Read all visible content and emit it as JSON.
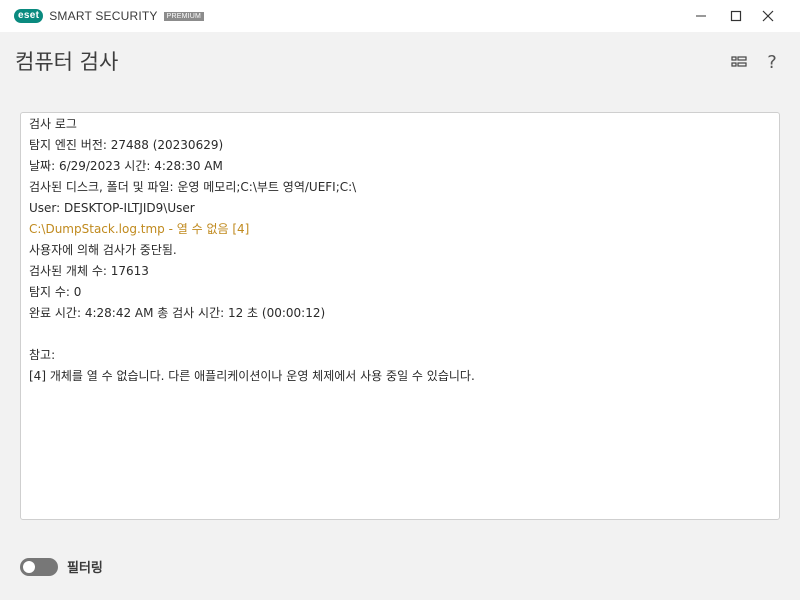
{
  "app": {
    "logo_text": "eset",
    "product_name": "SMART SECURITY",
    "edition": "PREMIUM",
    "accent_color": "#0a8a7f",
    "window_controls": [
      "minimize-icon",
      "maximize-icon",
      "close-icon"
    ]
  },
  "header": {
    "title": "컴퓨터 검사",
    "layout_icon": "layout-icon",
    "help_label": "?"
  },
  "log": {
    "lines": [
      "검사 로그",
      "탐지 엔진 버전: 27488 (20230629)",
      "날짜: 6/29/2023  시간: 4:28:30 AM",
      "검사된 디스크, 폴더 및 파일: 운영 메모리;C:\\부트 영역/UEFI;C:\\",
      "User: DESKTOP-ILTJID9\\User",
      "C:\\DumpStack.log.tmp - 열 수 없음 [4]",
      "사용자에 의해 검사가 중단됨.",
      "검사된 개체 수: 17613",
      "탐지 수: 0",
      "완료 시간: 4:28:42 AM  총 검사 시간: 12 초 (00:00:12)",
      "",
      "참고:",
      "[4] 개체를 열 수 없습니다. 다른 애플리케이션이나 운영 체제에서 사용 중일 수 있습니다."
    ],
    "warning_color": "#c08a1e"
  },
  "filter": {
    "label": "필터링",
    "enabled": false
  }
}
